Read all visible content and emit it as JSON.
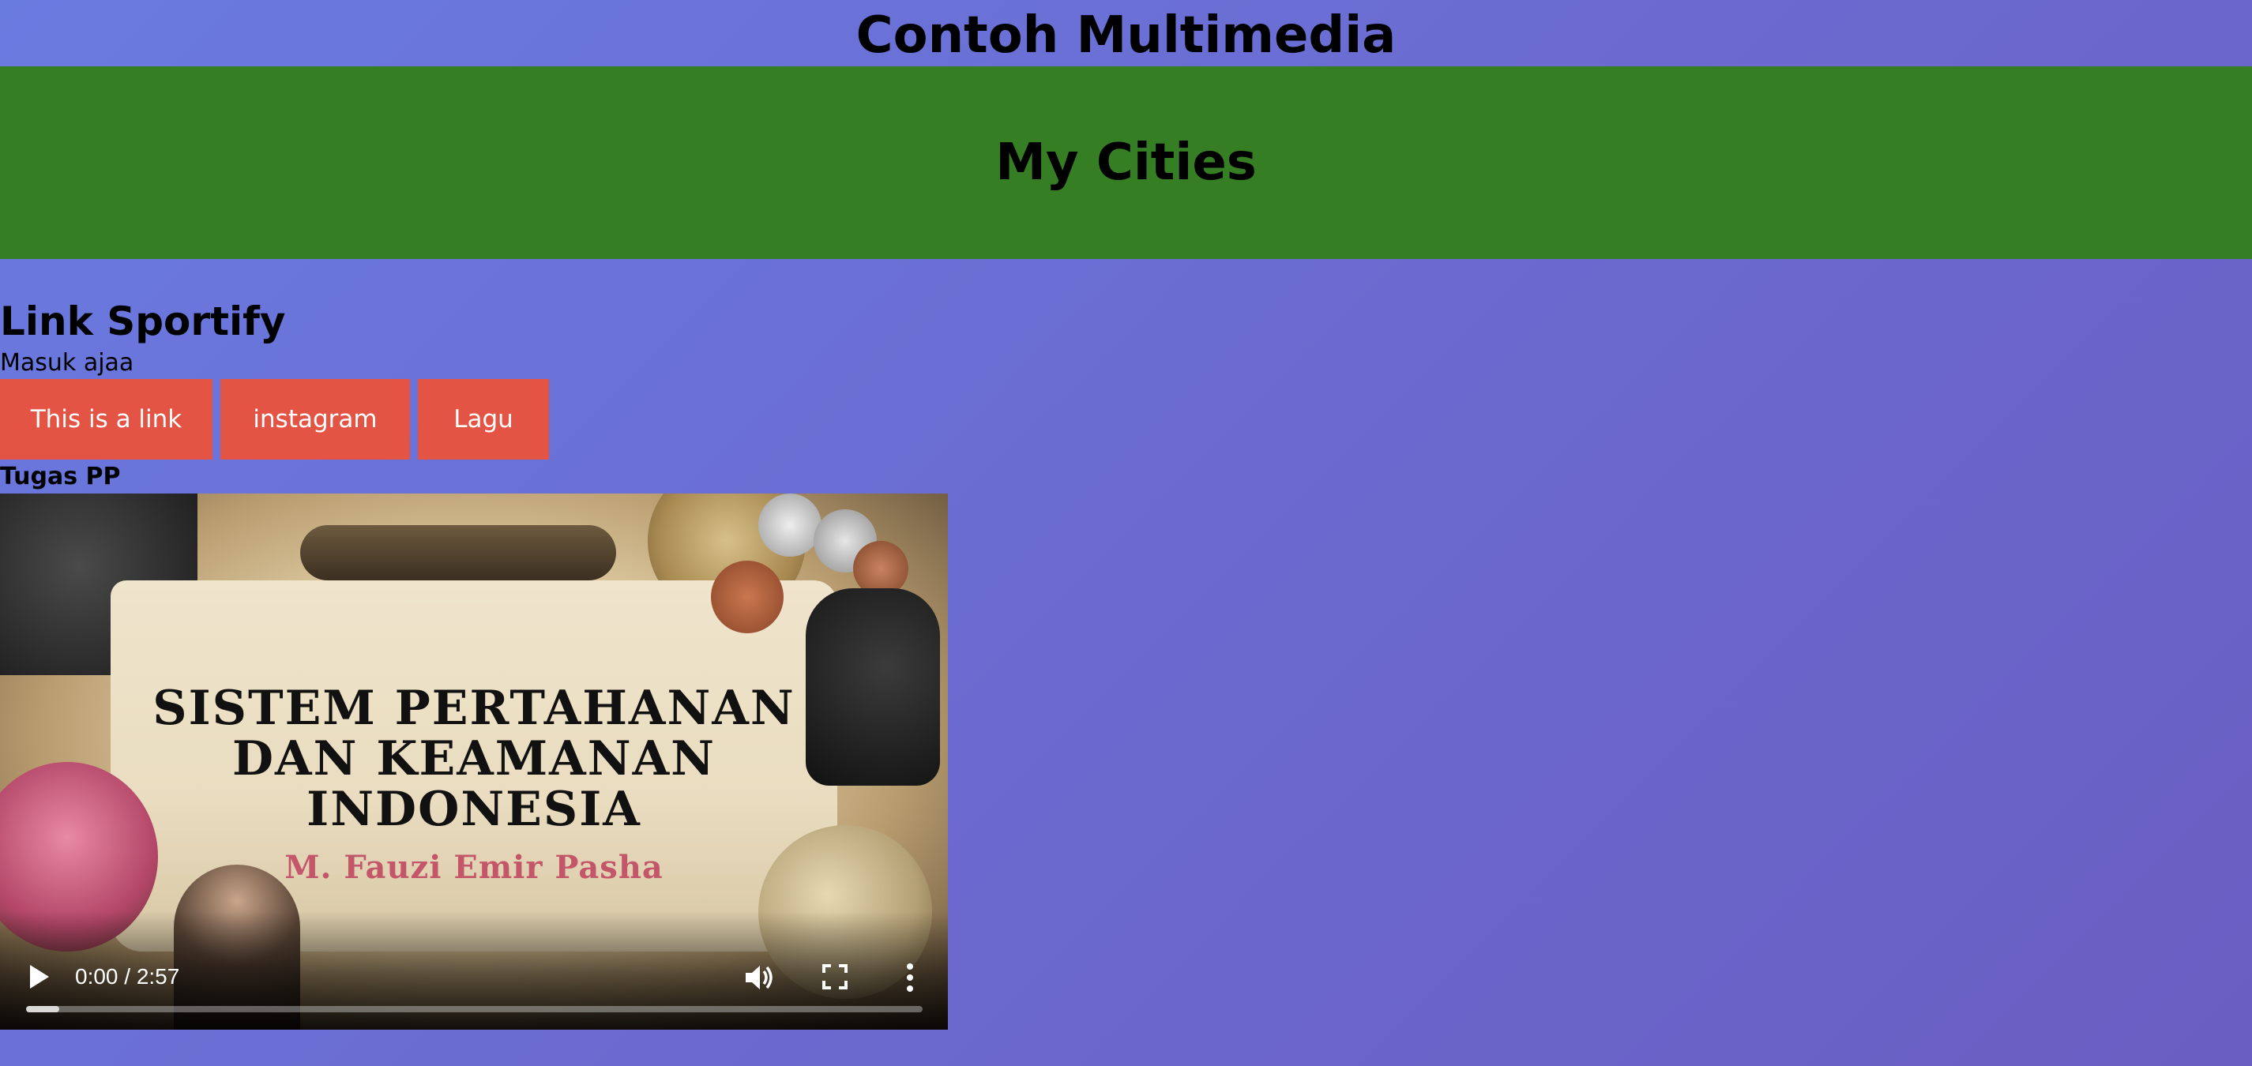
{
  "page": {
    "title": "Contoh Multimedia"
  },
  "banner": {
    "title": "My Cities",
    "background_color": "#367e24"
  },
  "links_section": {
    "heading": "Link Sportify",
    "subtitle": "Masuk ajaa",
    "button_color": "#e35444",
    "buttons": [
      {
        "label": "This is a link"
      },
      {
        "label": "instagram"
      },
      {
        "label": "Lagu"
      }
    ]
  },
  "video_section": {
    "label": "Tugas PP",
    "thumbnail": {
      "title": "SISTEM PERTAHANAN\nDAN KEAMANAN\nINDONESIA",
      "author": "M. Fauzi Emir Pasha"
    },
    "player": {
      "time_display": "0:00 / 2:57",
      "current_time": "0:00",
      "duration": "2:57",
      "progress_fraction": 0.0,
      "icons": [
        "play-icon",
        "volume-icon",
        "fullscreen-icon",
        "more-options-icon"
      ]
    }
  }
}
